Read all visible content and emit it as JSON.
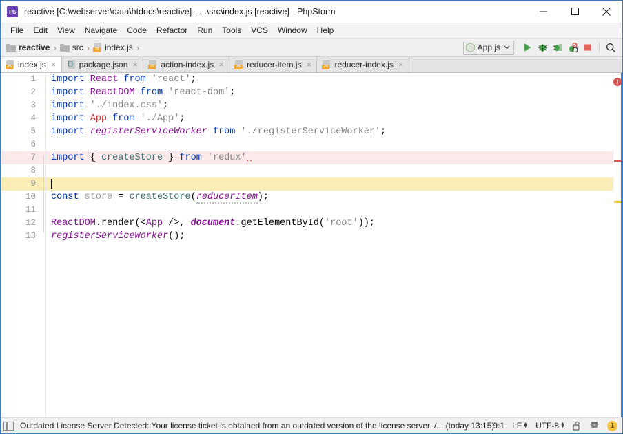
{
  "window": {
    "title": "reactive [C:\\webserver\\data\\htdocs\\reactive] - ...\\src\\index.js [reactive] - PhpStorm",
    "app_icon_text": "PS",
    "minimize_label": "minimize",
    "maximize_label": "maximize",
    "close_label": "close"
  },
  "menubar": {
    "items": [
      {
        "label": "File"
      },
      {
        "label": "Edit"
      },
      {
        "label": "View"
      },
      {
        "label": "Navigate"
      },
      {
        "label": "Code"
      },
      {
        "label": "Refactor"
      },
      {
        "label": "Run"
      },
      {
        "label": "Tools"
      },
      {
        "label": "VCS"
      },
      {
        "label": "Window"
      },
      {
        "label": "Help"
      }
    ]
  },
  "breadcrumb": {
    "separator": "›",
    "items": [
      {
        "label": "reactive",
        "icon": "folder-icon"
      },
      {
        "label": "src",
        "icon": "folder-icon"
      },
      {
        "label": "index.js",
        "icon": "js-file-icon"
      }
    ]
  },
  "toolbar": {
    "run_config": {
      "label": "App.js",
      "icon": "nodejs-icon",
      "chevron": "∨"
    },
    "buttons": [
      {
        "name": "run-button",
        "title": "Run"
      },
      {
        "name": "debug-button",
        "title": "Debug"
      },
      {
        "name": "run-with-coverage-button",
        "title": "Run with Coverage"
      },
      {
        "name": "stop-debugger-button",
        "title": "Stop Debugger"
      },
      {
        "name": "stop-button",
        "title": "Stop"
      },
      {
        "name": "search-everywhere-button",
        "title": "Search Everywhere"
      }
    ]
  },
  "tabs": [
    {
      "label": "index.js",
      "icon": "js-file-icon",
      "active": true,
      "close": "×"
    },
    {
      "label": "package.json",
      "icon": "json-file-icon",
      "active": false,
      "close": "×"
    },
    {
      "label": "action-index.js",
      "icon": "js-file-icon",
      "active": false,
      "close": "×"
    },
    {
      "label": "reducer-item.js",
      "icon": "js-file-icon",
      "active": false,
      "close": "×"
    },
    {
      "label": "reducer-index.js",
      "icon": "js-file-icon",
      "active": false,
      "close": "×"
    }
  ],
  "editor": {
    "line_numbers": [
      "1",
      "2",
      "3",
      "4",
      "5",
      "6",
      "7",
      "8",
      "9",
      "10",
      "11",
      "12",
      "13"
    ],
    "fold_glyph": "−",
    "breakpoint_line": 7,
    "caret_line": 9,
    "error_line": 7,
    "lines": [
      {
        "n": 1,
        "text": "import React from 'react';"
      },
      {
        "n": 2,
        "text": "import ReactDOM from 'react-dom';"
      },
      {
        "n": 3,
        "text": "import './index.css';"
      },
      {
        "n": 4,
        "text": "import App from './App';"
      },
      {
        "n": 5,
        "text": "import registerServiceWorker from './registerServiceWorker';"
      },
      {
        "n": 6,
        "text": ""
      },
      {
        "n": 7,
        "text": "import { createStore } from 'redux'"
      },
      {
        "n": 8,
        "text": ""
      },
      {
        "n": 9,
        "text": ""
      },
      {
        "n": 10,
        "text": "const store = createStore(reducerItem);"
      },
      {
        "n": 11,
        "text": ""
      },
      {
        "n": 12,
        "text": "ReactDOM.render(<App />, document.getElementById('root'));"
      },
      {
        "n": 13,
        "text": "registerServiceWorker();"
      }
    ]
  },
  "stripe": {
    "error_badge": "!",
    "markers": [
      {
        "color": "#d9544d",
        "line": 7
      },
      {
        "color": "#e8c422",
        "line": 10
      }
    ]
  },
  "statusbar": {
    "message": "Outdated License Server Detected: Your license ticket is obtained from an outdated version of the license server. /... (today 13:15)",
    "caret_position": "9:1",
    "line_separator": "LF",
    "encoding": "UTF-8",
    "lock_icon": "unlocked-padlock-icon",
    "inspection_icon": "inspector-icon",
    "event_badge": "1"
  },
  "colors": {
    "accent": "#3a7cc4",
    "keyword": "#0033b3",
    "class": "#871094",
    "string": "#848484",
    "error": "#c7302b",
    "caret_line": "#faeeb6",
    "error_line": "#fbeaea",
    "breakpoint": "#e46464",
    "js_badge": "#f0a732",
    "warning_badge": "#f5c344"
  }
}
